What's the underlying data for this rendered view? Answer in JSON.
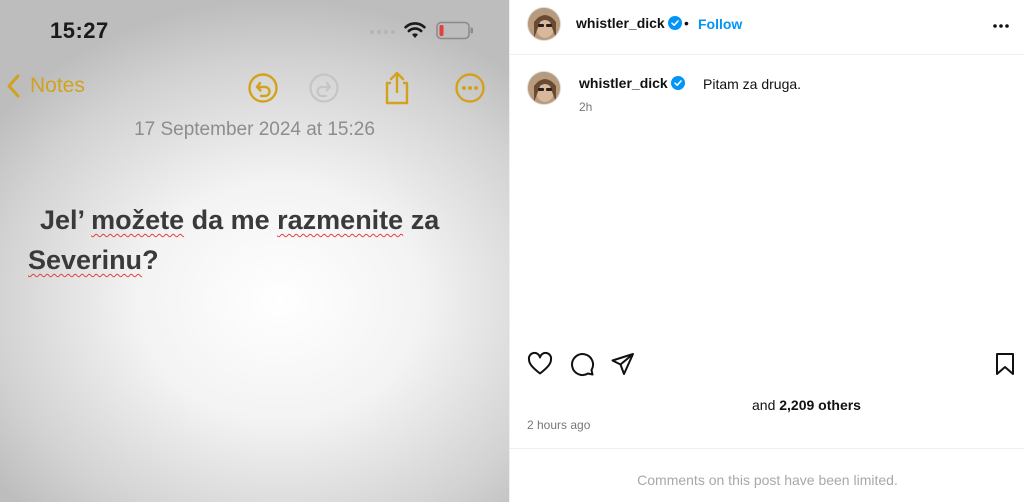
{
  "photo": {
    "status_time": "15:27",
    "notes_back_label": "Notes",
    "note_date": "17 September 2024 at 15:26",
    "note_line1_pre": "Jel’",
    "note_line1_w1": "možete",
    "note_line1_mid": " da me ",
    "note_line1_w2": "razmenite",
    "note_line1_post": " za",
    "note_line2_word": "Severinu",
    "note_line2_post": "?",
    "accent_color": "#d2a21d"
  },
  "post": {
    "username": "whistler_dick",
    "separator": "•",
    "follow_label": "Follow",
    "caption_username": "whistler_dick",
    "caption_text": "Pitam za druga.",
    "caption_time": "2h",
    "likes_prefix": "and ",
    "likes_count": "2,209 others",
    "post_time": "2 hours ago",
    "comments_note": "Comments on this post have been limited.",
    "link_color": "#0095f6"
  },
  "icons": {
    "actions": [
      "heart-icon",
      "comment-icon",
      "share-icon",
      "bookmark-icon"
    ],
    "toolbar": [
      "undo-icon",
      "redo-icon",
      "share-icon",
      "more-icon"
    ]
  }
}
